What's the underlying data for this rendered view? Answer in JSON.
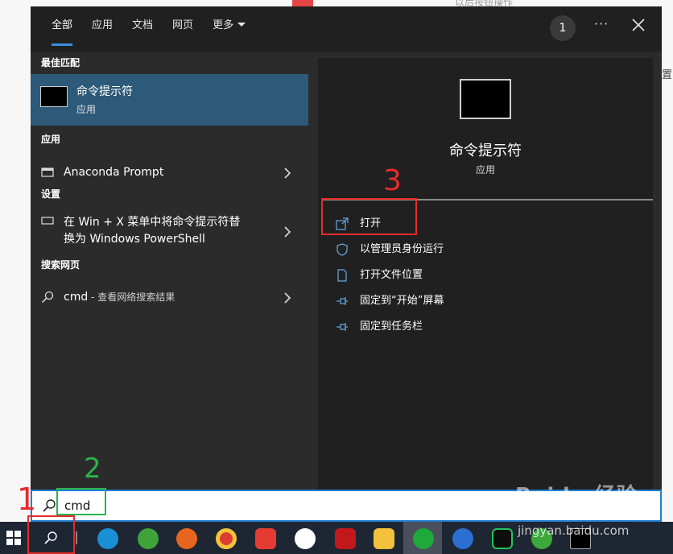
{
  "background": {
    "texts": [
      "以后按钮操作",
      "置"
    ]
  },
  "start_menu": {
    "tabs": [
      {
        "label": "全部",
        "active": true
      },
      {
        "label": "应用",
        "active": false
      },
      {
        "label": "文档",
        "active": false
      },
      {
        "label": "网页",
        "active": false
      },
      {
        "label": "更多",
        "active": false
      }
    ],
    "badge_count": "1",
    "more_dots": "···",
    "sections": {
      "best_match": "最佳匹配",
      "apps": "应用",
      "settings": "设置",
      "web": "搜索网页"
    },
    "best_match": {
      "title": "命令提示符",
      "subtitle": "应用"
    },
    "app_result": {
      "label": "Anaconda Prompt"
    },
    "setting_result": {
      "line1": "在 Win + X 菜单中将命令提示符替",
      "line2": "换为 Windows PowerShell"
    },
    "web_result": {
      "query": "cmd",
      "suffix": " - 查看网络搜索结果"
    },
    "detail": {
      "name": "命令提示符",
      "type": "应用",
      "actions": [
        {
          "label": "打开",
          "icon": "open-icon"
        },
        {
          "label": "以管理员身份运行",
          "icon": "shield-icon"
        },
        {
          "label": "打开文件位置",
          "icon": "folder-icon"
        },
        {
          "label": "固定到“开始”屏幕",
          "icon": "pin-icon"
        },
        {
          "label": "固定到任务栏",
          "icon": "pin-icon"
        }
      ]
    }
  },
  "search": {
    "value": "cmd"
  },
  "annotations": {
    "step1": "1",
    "step2": "2",
    "step3": "3"
  },
  "watermark": {
    "brand": "Baidu 经验",
    "url": "jingyan.baidu.com"
  },
  "colors": {
    "accent": "#3a8fdd",
    "selected": "#2c5a78",
    "annotation_red": "#e52b2b",
    "annotation_green": "#2bb34a"
  }
}
